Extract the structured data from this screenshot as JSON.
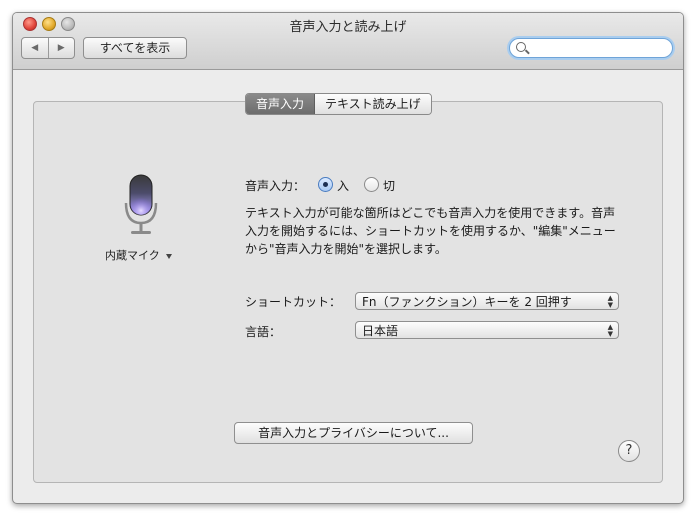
{
  "window": {
    "title": "音声入力と読み上げ"
  },
  "toolbar": {
    "back_icon": "◀",
    "forward_icon": "▶",
    "show_all_label": "すべてを表示",
    "search_placeholder": ""
  },
  "tabs": [
    {
      "label": "音声入力",
      "active": true
    },
    {
      "label": "テキスト読み上げ",
      "active": false
    }
  ],
  "microphone": {
    "label": "内蔵マイク"
  },
  "dictation": {
    "label": "音声入力：",
    "on_label": "入",
    "off_label": "切",
    "selected": "入",
    "description": "テキスト入力が可能な箇所はどこでも音声入力を使用できます。音声入力を開始するには、ショートカットを使用するか、\"編集\"メニューから\"音声入力を開始\"を選択します。"
  },
  "shortcut": {
    "label": "ショートカット：",
    "value": "Fn（ファンクション）キーを 2 回押す"
  },
  "language": {
    "label": "言語：",
    "value": "日本語"
  },
  "privacy_button_label": "音声入力とプライバシーについて...",
  "help_label": "?",
  "colors": {
    "radio_selected": "#4a7cc0",
    "mic_glow": "#8a6cf0"
  }
}
